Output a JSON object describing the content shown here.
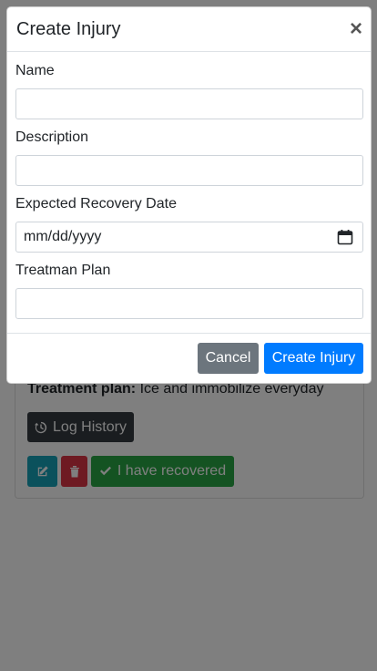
{
  "background": {
    "treatment_label": "Treatment plan:",
    "treatment_value": "Ice and immobilize everyday",
    "log_history_label": "Log History",
    "recovered_label": "I have recovered"
  },
  "modal": {
    "title": "Create Injury",
    "close_glyph": "×",
    "fields": [
      {
        "label": "Name",
        "value": ""
      },
      {
        "label": "Description",
        "value": ""
      },
      {
        "label": "Expected Recovery Date",
        "placeholder": "mm/dd/yyyy"
      },
      {
        "label": "Treatman Plan",
        "value": ""
      }
    ],
    "cancel_label": "Cancel",
    "create_label": "Create Injury"
  },
  "colors": {
    "primary": "#007bff",
    "secondary": "#6c757d",
    "dark": "#343a40",
    "info": "#17a2b8",
    "danger": "#dc3545",
    "success": "#28a745"
  },
  "icons": [
    "history-icon",
    "edit-icon",
    "trash-icon",
    "check-icon",
    "calendar-icon",
    "close-icon"
  ]
}
